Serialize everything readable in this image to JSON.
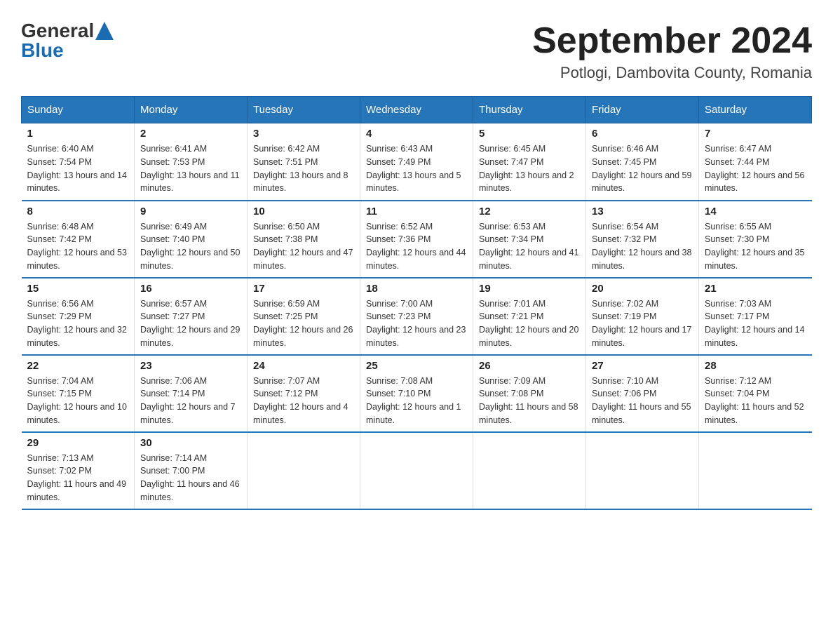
{
  "header": {
    "logo_general": "General",
    "logo_blue": "Blue",
    "title": "September 2024",
    "subtitle": "Potlogi, Dambovita County, Romania"
  },
  "weekdays": [
    "Sunday",
    "Monday",
    "Tuesday",
    "Wednesday",
    "Thursday",
    "Friday",
    "Saturday"
  ],
  "weeks": [
    [
      {
        "day": "1",
        "sunrise": "6:40 AM",
        "sunset": "7:54 PM",
        "daylight": "13 hours and 14 minutes."
      },
      {
        "day": "2",
        "sunrise": "6:41 AM",
        "sunset": "7:53 PM",
        "daylight": "13 hours and 11 minutes."
      },
      {
        "day": "3",
        "sunrise": "6:42 AM",
        "sunset": "7:51 PM",
        "daylight": "13 hours and 8 minutes."
      },
      {
        "day": "4",
        "sunrise": "6:43 AM",
        "sunset": "7:49 PM",
        "daylight": "13 hours and 5 minutes."
      },
      {
        "day": "5",
        "sunrise": "6:45 AM",
        "sunset": "7:47 PM",
        "daylight": "13 hours and 2 minutes."
      },
      {
        "day": "6",
        "sunrise": "6:46 AM",
        "sunset": "7:45 PM",
        "daylight": "12 hours and 59 minutes."
      },
      {
        "day": "7",
        "sunrise": "6:47 AM",
        "sunset": "7:44 PM",
        "daylight": "12 hours and 56 minutes."
      }
    ],
    [
      {
        "day": "8",
        "sunrise": "6:48 AM",
        "sunset": "7:42 PM",
        "daylight": "12 hours and 53 minutes."
      },
      {
        "day": "9",
        "sunrise": "6:49 AM",
        "sunset": "7:40 PM",
        "daylight": "12 hours and 50 minutes."
      },
      {
        "day": "10",
        "sunrise": "6:50 AM",
        "sunset": "7:38 PM",
        "daylight": "12 hours and 47 minutes."
      },
      {
        "day": "11",
        "sunrise": "6:52 AM",
        "sunset": "7:36 PM",
        "daylight": "12 hours and 44 minutes."
      },
      {
        "day": "12",
        "sunrise": "6:53 AM",
        "sunset": "7:34 PM",
        "daylight": "12 hours and 41 minutes."
      },
      {
        "day": "13",
        "sunrise": "6:54 AM",
        "sunset": "7:32 PM",
        "daylight": "12 hours and 38 minutes."
      },
      {
        "day": "14",
        "sunrise": "6:55 AM",
        "sunset": "7:30 PM",
        "daylight": "12 hours and 35 minutes."
      }
    ],
    [
      {
        "day": "15",
        "sunrise": "6:56 AM",
        "sunset": "7:29 PM",
        "daylight": "12 hours and 32 minutes."
      },
      {
        "day": "16",
        "sunrise": "6:57 AM",
        "sunset": "7:27 PM",
        "daylight": "12 hours and 29 minutes."
      },
      {
        "day": "17",
        "sunrise": "6:59 AM",
        "sunset": "7:25 PM",
        "daylight": "12 hours and 26 minutes."
      },
      {
        "day": "18",
        "sunrise": "7:00 AM",
        "sunset": "7:23 PM",
        "daylight": "12 hours and 23 minutes."
      },
      {
        "day": "19",
        "sunrise": "7:01 AM",
        "sunset": "7:21 PM",
        "daylight": "12 hours and 20 minutes."
      },
      {
        "day": "20",
        "sunrise": "7:02 AM",
        "sunset": "7:19 PM",
        "daylight": "12 hours and 17 minutes."
      },
      {
        "day": "21",
        "sunrise": "7:03 AM",
        "sunset": "7:17 PM",
        "daylight": "12 hours and 14 minutes."
      }
    ],
    [
      {
        "day": "22",
        "sunrise": "7:04 AM",
        "sunset": "7:15 PM",
        "daylight": "12 hours and 10 minutes."
      },
      {
        "day": "23",
        "sunrise": "7:06 AM",
        "sunset": "7:14 PM",
        "daylight": "12 hours and 7 minutes."
      },
      {
        "day": "24",
        "sunrise": "7:07 AM",
        "sunset": "7:12 PM",
        "daylight": "12 hours and 4 minutes."
      },
      {
        "day": "25",
        "sunrise": "7:08 AM",
        "sunset": "7:10 PM",
        "daylight": "12 hours and 1 minute."
      },
      {
        "day": "26",
        "sunrise": "7:09 AM",
        "sunset": "7:08 PM",
        "daylight": "11 hours and 58 minutes."
      },
      {
        "day": "27",
        "sunrise": "7:10 AM",
        "sunset": "7:06 PM",
        "daylight": "11 hours and 55 minutes."
      },
      {
        "day": "28",
        "sunrise": "7:12 AM",
        "sunset": "7:04 PM",
        "daylight": "11 hours and 52 minutes."
      }
    ],
    [
      {
        "day": "29",
        "sunrise": "7:13 AM",
        "sunset": "7:02 PM",
        "daylight": "11 hours and 49 minutes."
      },
      {
        "day": "30",
        "sunrise": "7:14 AM",
        "sunset": "7:00 PM",
        "daylight": "11 hours and 46 minutes."
      },
      null,
      null,
      null,
      null,
      null
    ]
  ],
  "labels": {
    "sunrise_label": "Sunrise: ",
    "sunset_label": "Sunset: ",
    "daylight_label": "Daylight: "
  }
}
